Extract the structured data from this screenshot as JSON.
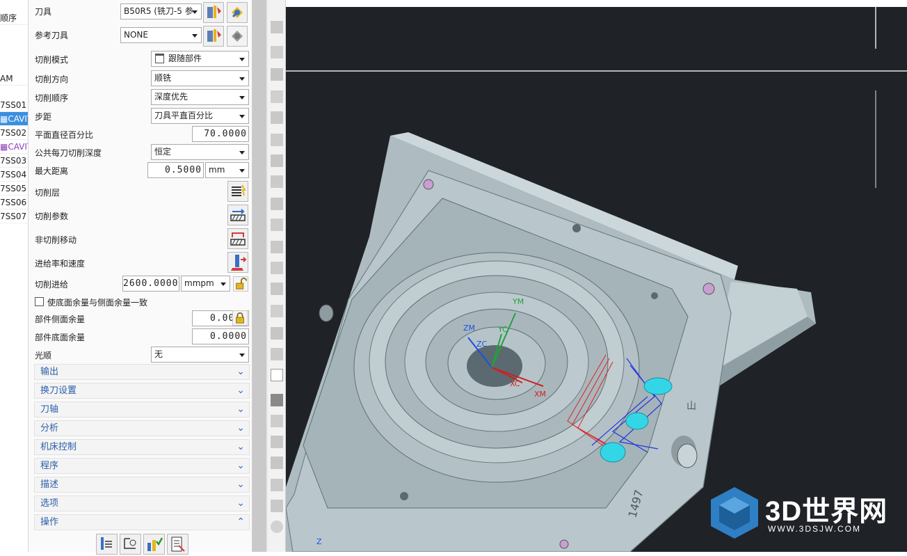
{
  "navigator": {
    "rows": [
      {
        "text": "顺序"
      },
      {
        "text": "AM"
      },
      {
        "text": "7SS01"
      },
      {
        "text": "CAVIT"
      },
      {
        "text": "7SS02"
      },
      {
        "text": "CAVIT"
      },
      {
        "text": "7SS03"
      },
      {
        "text": "7SS04"
      },
      {
        "text": "7SS05"
      },
      {
        "text": "7SS06"
      },
      {
        "text": "7SS07"
      }
    ]
  },
  "panel": {
    "tool_label": "刀具",
    "tool_value": "B50R5 (铣刀-5 参",
    "ref_tool_label": "参考刀具",
    "ref_tool_value": "NONE",
    "cut_pattern_label": "切削模式",
    "cut_pattern_value": "跟随部件",
    "cut_direction_label": "切削方向",
    "cut_direction_value": "顺铣",
    "cut_order_label": "切削顺序",
    "cut_order_value": "深度优先",
    "stepover_label": "步距",
    "stepover_value": "刀具平直百分比",
    "flat_percent_label": "平面直径百分比",
    "flat_percent_value": "70.0000",
    "common_depth_label": "公共每刀切削深度",
    "common_depth_value": "恒定",
    "max_distance_label": "最大距离",
    "max_distance_value": "0.5000",
    "max_distance_unit": "mm",
    "cut_levels_label": "切削层",
    "cut_params_label": "切削参数",
    "non_cut_label": "非切削移动",
    "feeds_label": "进给率和速度",
    "cut_feed_label": "切削进给",
    "cut_feed_value": "2600.0000",
    "cut_feed_unit": "mmpm",
    "same_stock_label": "使底面余量与侧面余量一致",
    "side_stock_label": "部件侧面余量",
    "side_stock_value": "0.0000",
    "floor_stock_label": "部件底面余量",
    "floor_stock_value": "0.0000",
    "smoothing_label": "光顺",
    "smoothing_value": "无",
    "sections": [
      "输出",
      "换刀设置",
      "刀轴",
      "分析",
      "机床控制",
      "程序",
      "描述",
      "选项",
      "操作"
    ]
  },
  "view": {
    "axis_labels": {
      "zm": "ZM",
      "zc": "ZC",
      "ym": "YM",
      "yc": "YC",
      "xc": "XC",
      "xm": "XM",
      "z": "Z"
    },
    "part_marking": "1497",
    "part_marking2": "山"
  },
  "watermark": {
    "title": "3D世界网",
    "url": "WWW.3DSJW.COM"
  },
  "colors": {
    "selection": "#3b8fe0",
    "section_text": "#2b5fa8",
    "viewport_bg": "#1f2226",
    "part": "#b9c7cc"
  }
}
